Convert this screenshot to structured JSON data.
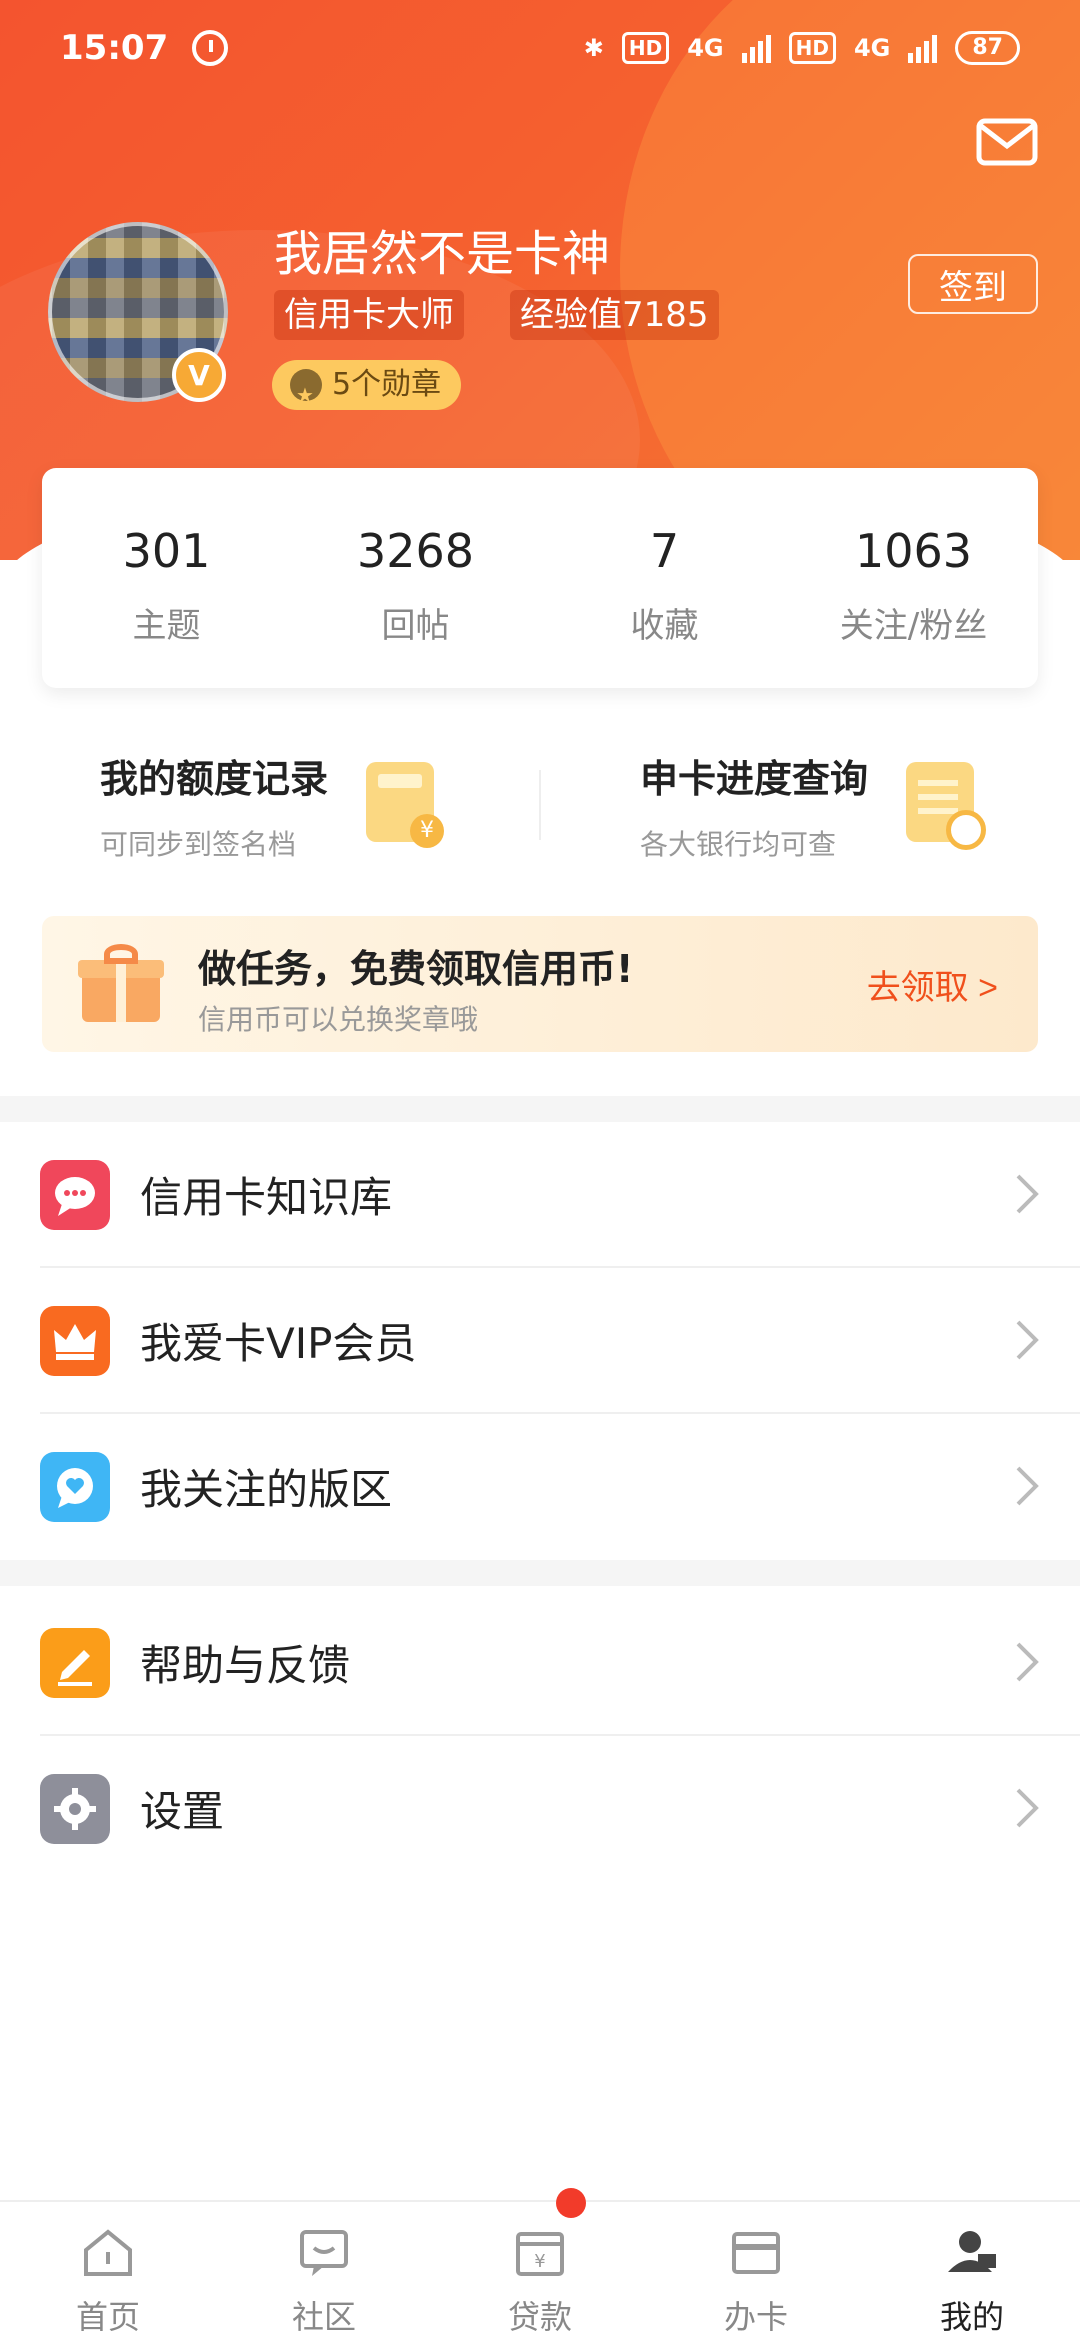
{
  "status_bar": {
    "time": "15:07",
    "hd1": "HD",
    "net1": "4G",
    "hd2": "HD",
    "net2": "4G",
    "battery": "87"
  },
  "profile": {
    "name": "我居然不是卡神",
    "title_tag": "信用卡大师",
    "exp_tag": "经验值7185",
    "medal_text": "5个勋章",
    "verified_badge": "V",
    "signin_label": "签到"
  },
  "stats": [
    {
      "value": "301",
      "label": "主题"
    },
    {
      "value": "3268",
      "label": "回帖"
    },
    {
      "value": "7",
      "label": "收藏"
    },
    {
      "value": "1063",
      "label": "关注/粉丝"
    }
  ],
  "tools": [
    {
      "title": "我的额度记录",
      "subtitle": "可同步到签名档",
      "icon": "calculator-icon"
    },
    {
      "title": "申卡进度查询",
      "subtitle": "各大银行均可查",
      "icon": "document-search-icon"
    }
  ],
  "task_banner": {
    "title": "做任务，免费领取信用币!",
    "subtitle": "信用币可以兑换奖章哦",
    "action": "去领取 >"
  },
  "menu_group1": [
    {
      "label": "信用卡知识库",
      "icon": "chat-bubble-icon",
      "color": "#f0475b"
    },
    {
      "label": "我爱卡VIP会员",
      "icon": "crown-icon",
      "color": "#f96a20"
    },
    {
      "label": "我关注的版区",
      "icon": "heart-bubble-icon",
      "color": "#3fb6f5"
    }
  ],
  "menu_group2": [
    {
      "label": "帮助与反馈",
      "icon": "pencil-icon",
      "color": "#fb9d19"
    },
    {
      "label": "设置",
      "icon": "gear-icon",
      "color": "#8e8f9a"
    }
  ],
  "tabbar": [
    {
      "label": "首页",
      "icon": "home-icon"
    },
    {
      "label": "社区",
      "icon": "chat-icon"
    },
    {
      "label": "贷款",
      "icon": "loan-icon"
    },
    {
      "label": "办卡",
      "icon": "card-icon"
    },
    {
      "label": "我的",
      "icon": "profile-icon",
      "active": true
    }
  ],
  "colors": {
    "brand": "#f4542f",
    "accent": "#f0501c",
    "badge": "#fdc95f"
  }
}
